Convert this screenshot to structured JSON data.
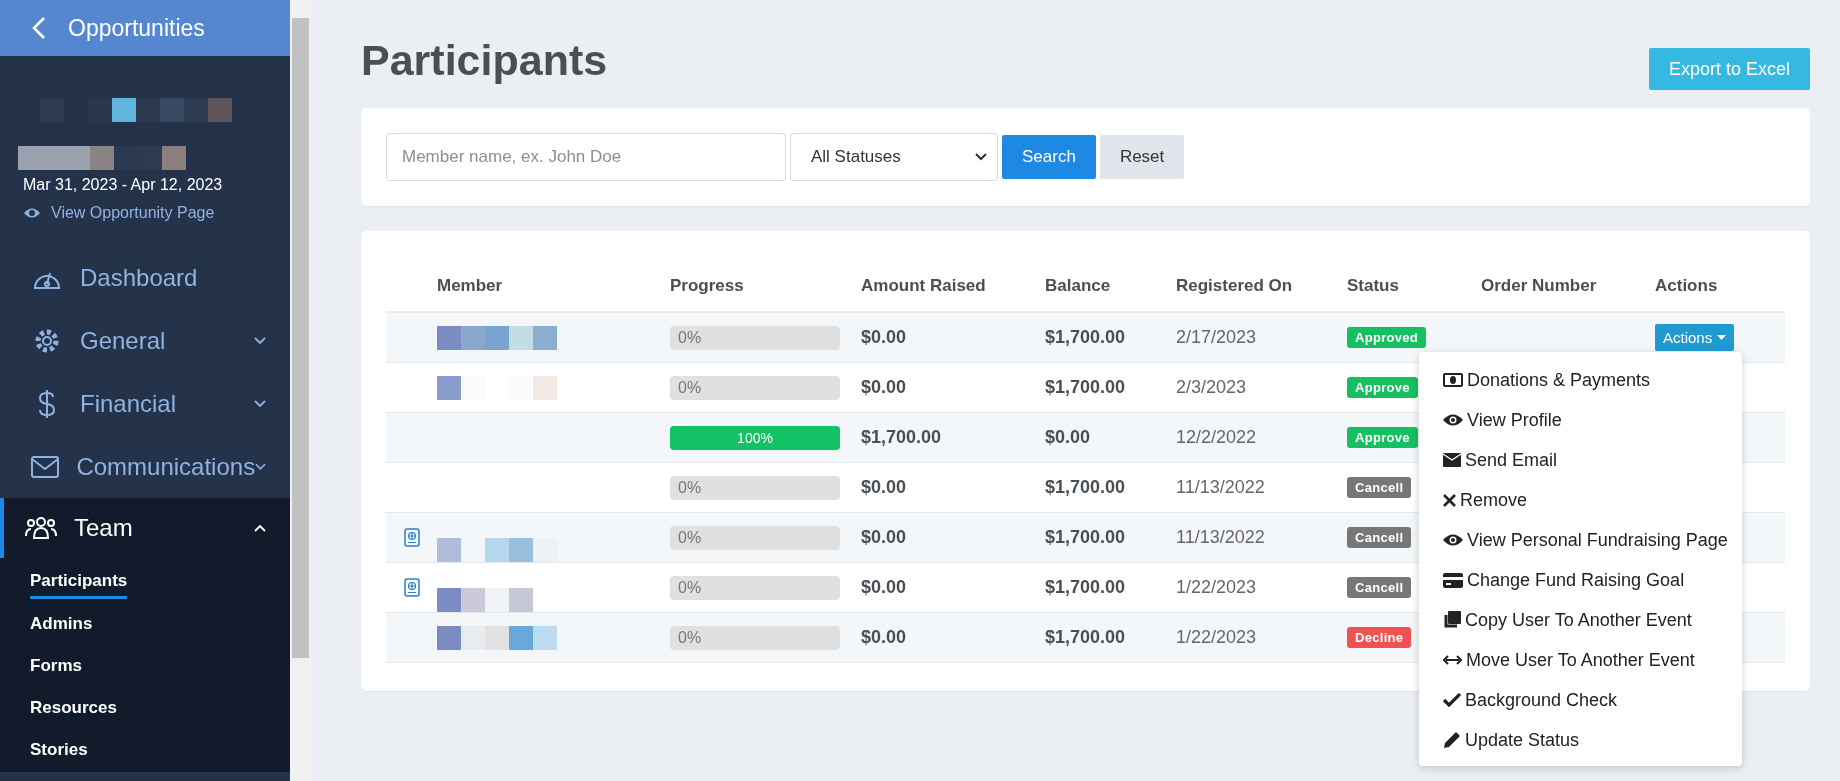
{
  "sidebar": {
    "back_label": "Opportunities",
    "dates": "Mar 31, 2023 - Apr 12, 2023",
    "view_link": "View Opportunity Page",
    "items": [
      {
        "label": "Dashboard",
        "kind": "link",
        "selected": false
      },
      {
        "label": "General",
        "kind": "group",
        "expanded": false,
        "selected": false
      },
      {
        "label": "Financial",
        "kind": "group",
        "expanded": false,
        "selected": false
      },
      {
        "label": "Communications",
        "kind": "group",
        "expanded": false,
        "selected": false
      },
      {
        "label": "Team",
        "kind": "group",
        "expanded": true,
        "selected": true,
        "children": [
          {
            "label": "Participants",
            "selected": true
          },
          {
            "label": "Admins",
            "selected": false
          },
          {
            "label": "Forms",
            "selected": false
          },
          {
            "label": "Resources",
            "selected": false
          },
          {
            "label": "Stories",
            "selected": false
          }
        ]
      }
    ]
  },
  "page": {
    "title": "Participants",
    "export_button": "Export to Excel"
  },
  "filters": {
    "search": {
      "placeholder": "Member name, ex. John Doe"
    },
    "status_select": "All Statuses",
    "search_button": "Search",
    "reset_button": "Reset"
  },
  "table": {
    "columns": [
      "Member",
      "Progress",
      "Amount Raised",
      "Balance",
      "Registered On",
      "Status",
      "Order Number",
      "Actions"
    ],
    "rows": [
      {
        "has_doc_icon": false,
        "level": 0,
        "progress": "0%",
        "amount_raised": "$0.00",
        "balance": "$1,700.00",
        "registered_on": "2/17/2023",
        "status": "Approved",
        "color": "#16c060",
        "actions": "Actions"
      },
      {
        "has_doc_icon": false,
        "level": 0,
        "progress": "0%",
        "amount_raised": "$0.00",
        "balance": "$1,700.00",
        "registered_on": "2/3/2023",
        "status": "Approve",
        "color": "#16c060"
      },
      {
        "has_doc_icon": false,
        "level": 1,
        "progress": "100%",
        "amount_raised": "$1,700.00",
        "balance": "$0.00",
        "registered_on": "12/2/2022",
        "status": "Approve",
        "color": "#16c060"
      },
      {
        "has_doc_icon": false,
        "level": 0,
        "progress": "0%",
        "amount_raised": "$0.00",
        "balance": "$1,700.00",
        "registered_on": "11/13/2022",
        "status": "Cancell",
        "color": "#777777"
      },
      {
        "has_doc_icon": true,
        "level": 0,
        "progress": "0%",
        "amount_raised": "$0.00",
        "balance": "$1,700.00",
        "registered_on": "11/13/2022",
        "status": "Cancell",
        "color": "#777777"
      },
      {
        "has_doc_icon": true,
        "level": 0,
        "progress": "0%",
        "amount_raised": "$0.00",
        "balance": "$1,700.00",
        "registered_on": "1/22/2023",
        "status": "Cancell",
        "color": "#777777"
      },
      {
        "has_doc_icon": false,
        "level": 0,
        "progress": "0%",
        "amount_raised": "$0.00",
        "balance": "$1,700.00",
        "registered_on": "1/22/2023",
        "status": "Decline",
        "color": "#f05252"
      }
    ]
  },
  "actions_menu": {
    "items": [
      "Donations & Payments",
      "View Profile",
      "Send Email",
      "Remove",
      "View Personal Fundraising Page",
      "Change Fund Raising Goal",
      "Copy User To Another Event",
      "Move User To Another Event",
      "Background Check",
      "Update Status"
    ]
  }
}
